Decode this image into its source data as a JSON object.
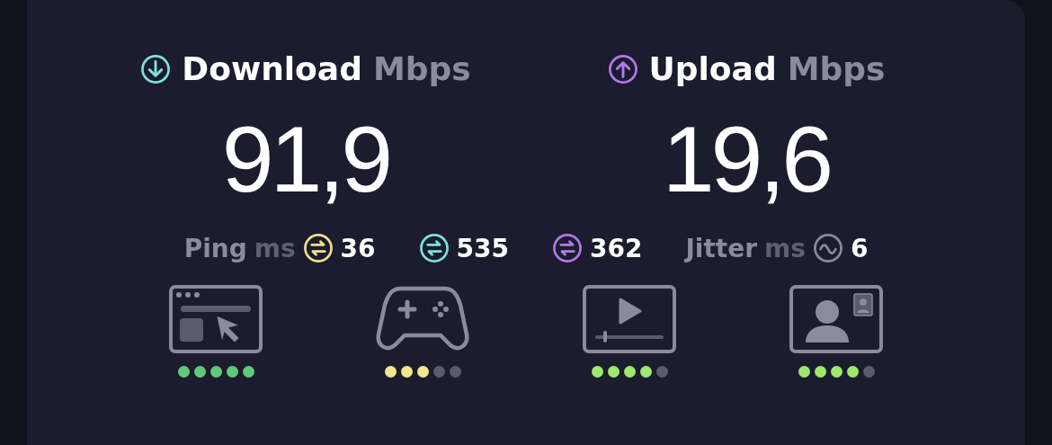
{
  "speeds": [
    {
      "kind": "download",
      "label": "Download",
      "unit": "Mbps",
      "value": "91,9",
      "color": "#7ee0e0"
    },
    {
      "kind": "upload",
      "label": "Upload",
      "unit": "Mbps",
      "value": "19,6",
      "color": "#b07ae8"
    }
  ],
  "latency": [
    {
      "kind": "ping",
      "label": "Ping",
      "unit": "ms",
      "value": "36",
      "color": "#f3e08a"
    },
    {
      "kind": "loaded",
      "value": "535",
      "color": "#7ee0e0"
    },
    {
      "kind": "loaded",
      "value": "362",
      "color": "#b07ae8"
    },
    {
      "kind": "jitter",
      "label": "Jitter",
      "unit": "ms",
      "value": "6",
      "color": "#8a8b9c"
    }
  ],
  "activities": [
    {
      "kind": "browsing",
      "stars": 5,
      "color": "#5ec97a"
    },
    {
      "kind": "gaming",
      "stars": 3,
      "color": "#f6e58d"
    },
    {
      "kind": "streaming",
      "stars": 4,
      "color": "#9fe870"
    },
    {
      "kind": "video-call",
      "stars": 4,
      "color": "#9fe870"
    }
  ]
}
